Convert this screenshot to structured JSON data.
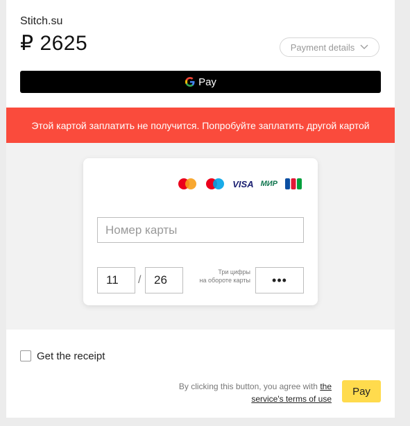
{
  "merchant": {
    "name": "Stitch.su"
  },
  "amount": {
    "currency": "₽",
    "value": "2625"
  },
  "payment_details": {
    "label": "Payment details"
  },
  "gpay": {
    "label": "Pay"
  },
  "error": {
    "message": "Этой картой заплатить не получится. Попробуйте заплатить другой картой"
  },
  "card_logos": {
    "visa": "VISA",
    "mir": "МИР",
    "jcb": "JCB"
  },
  "form": {
    "card_number_placeholder": "Номер карты",
    "exp_month": "11",
    "exp_separator": "/",
    "exp_year": "26",
    "cvc_label_line1": "Три цифры",
    "cvc_label_line2": "на обороте карты",
    "cvc_value": "•••"
  },
  "receipt": {
    "label": "Get the receipt",
    "checked": false
  },
  "terms": {
    "prefix": "By clicking this button, you agree with",
    "link_line1": "the",
    "link_line2": "service's terms of use"
  },
  "pay_button": {
    "label": "Pay",
    "color": "#ffdb4d"
  },
  "colors": {
    "error_bg": "#fa4b3c",
    "gpay_bg": "#000000"
  }
}
